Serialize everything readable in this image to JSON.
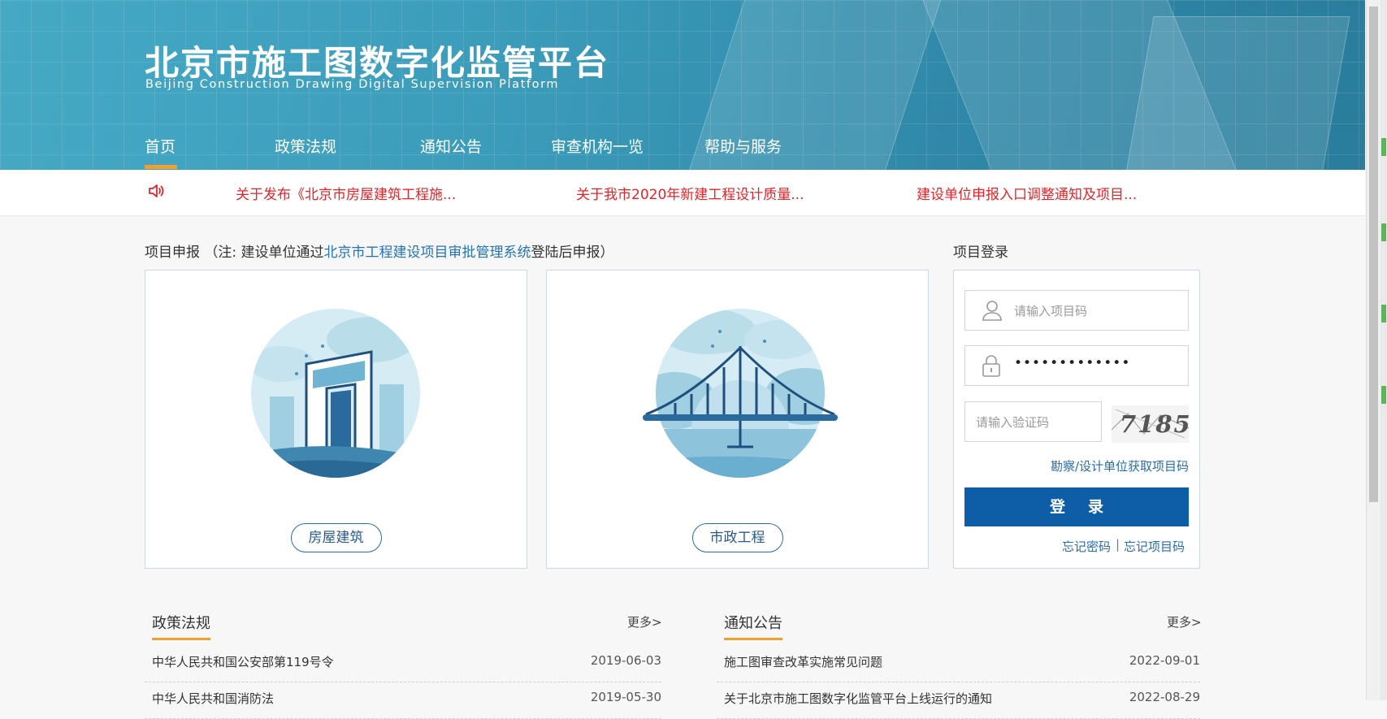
{
  "header": {
    "title_cn": "北京市施工图数字化监管平台",
    "title_en": "Beijing Construction Drawing Digital Supervision Platform"
  },
  "nav": [
    {
      "label": "首页",
      "active": true
    },
    {
      "label": "政策法规"
    },
    {
      "label": "通知公告"
    },
    {
      "label": "审查机构一览"
    },
    {
      "label": "帮助与服务"
    }
  ],
  "ticker": [
    "关于发布《北京市房屋建筑工程施...",
    "关于我市2020年新建工程设计质量...",
    "建设单位申报入口调整通知及项目..."
  ],
  "project_apply": {
    "title_prefix": "项目申报 （注: 建设单位通过",
    "title_link": "北京市工程建设项目审批管理系统",
    "title_suffix": "登陆后申报）",
    "cards": [
      {
        "label": "房屋建筑"
      },
      {
        "label": "市政工程"
      }
    ]
  },
  "login": {
    "title": "项目登录",
    "project_code_placeholder": "请输入项目码",
    "password_value": "•••••••••••••",
    "captcha_placeholder": "请输入验证码",
    "captcha_text": "7185",
    "get_code_link": "勘察/设计单位获取项目码",
    "login_button": "登录",
    "forgot_password": "忘记密码",
    "separator": "|",
    "forgot_code": "忘记项目码"
  },
  "policy": {
    "title": "政策法规",
    "more": "更多>",
    "items": [
      {
        "title": "中华人民共和国公安部第119号令",
        "date": "2019-06-03"
      },
      {
        "title": "中华人民共和国消防法",
        "date": "2019-05-30"
      }
    ]
  },
  "notice": {
    "title": "通知公告",
    "more": "更多>",
    "items": [
      {
        "title": "施工图审查改革实施常见问题",
        "date": "2022-09-01"
      },
      {
        "title": "关于北京市施工图数字化监管平台上线运行的通知",
        "date": "2022-08-29"
      }
    ]
  },
  "colors": {
    "header_bg": "#3c9dbb",
    "accent_orange": "#f0a02e",
    "ticker_red": "#e0262b",
    "link_blue": "#2573b6",
    "button_blue": "#0d5ea6"
  }
}
